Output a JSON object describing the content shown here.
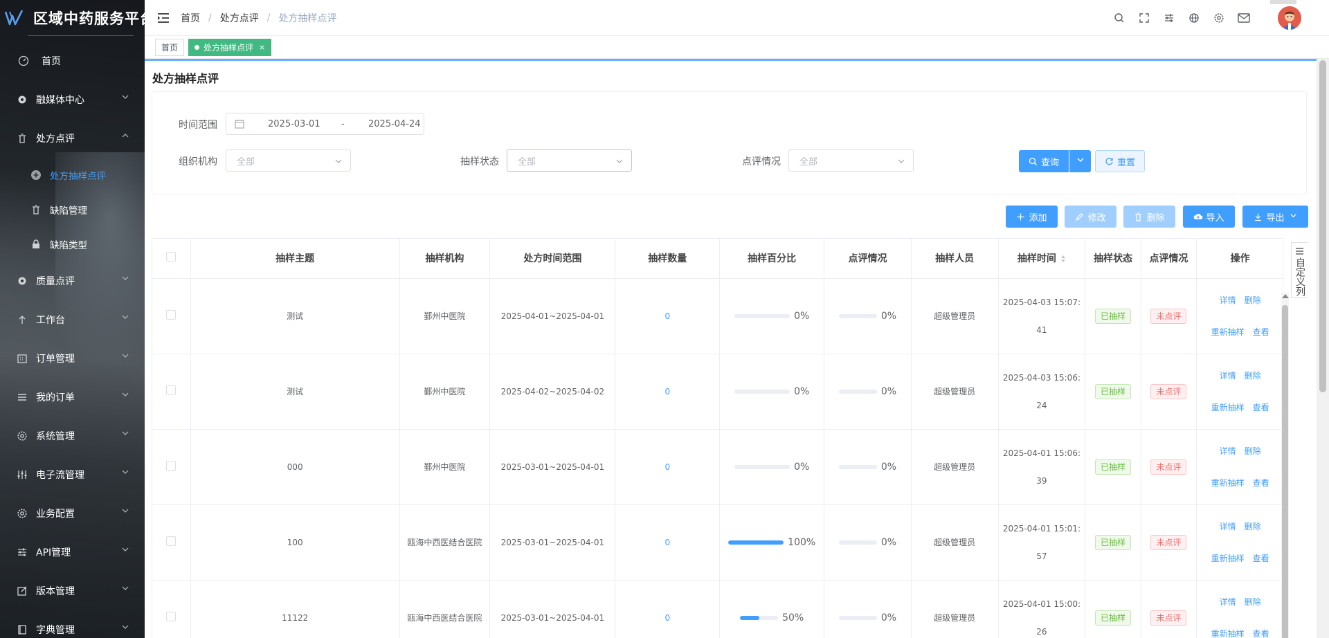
{
  "app": {
    "title": "区域中药服务平台"
  },
  "sidebar": {
    "items": [
      {
        "label": "首页",
        "icon": "dashboard-icon"
      },
      {
        "label": "融媒体中心",
        "icon": "settings-icon"
      },
      {
        "label": "处方点评",
        "icon": "trash-icon"
      },
      {
        "label": "处方抽样点评",
        "icon": "plus-circle-icon",
        "active": true
      },
      {
        "label": "缺陷管理",
        "icon": "trash-icon"
      },
      {
        "label": "缺陷类型",
        "icon": "lock-icon"
      },
      {
        "label": "质量点评",
        "icon": "settings-icon"
      },
      {
        "label": "工作台",
        "icon": "arrow-up-icon"
      },
      {
        "label": "订单管理",
        "icon": "calendar-icon"
      },
      {
        "label": "我的订单",
        "icon": "list-icon"
      },
      {
        "label": "系统管理",
        "icon": "gear-icon"
      },
      {
        "label": "电子流管理",
        "icon": "flow-icon"
      },
      {
        "label": "业务配置",
        "icon": "gear-icon"
      },
      {
        "label": "API管理",
        "icon": "sliders-icon"
      },
      {
        "label": "版本管理",
        "icon": "edit-icon"
      },
      {
        "label": "字典管理",
        "icon": "book-icon"
      }
    ]
  },
  "breadcrumb": {
    "home": "首页",
    "parent": "处方点评",
    "current": "处方抽样点评"
  },
  "tags": {
    "home": "首页",
    "active": "处方抽样点评",
    "close": "×"
  },
  "page": {
    "title": "处方抽样点评"
  },
  "filters": {
    "time_label": "时间范围",
    "start_date": "2025-03-01",
    "separator": "-",
    "end_date": "2025-04-24",
    "org_label": "组织机构",
    "org_value": "全部",
    "status_label": "抽样状态",
    "status_value": "全部",
    "review_label": "点评情况",
    "review_value": "全部",
    "query": "查询",
    "reset": "重置"
  },
  "actions": {
    "add": "添加",
    "edit": "修改",
    "delete": "删除",
    "import": "导入",
    "export": "导出"
  },
  "table": {
    "headers": [
      "抽样主题",
      "抽样机构",
      "处方时间范围",
      "抽样数量",
      "抽样百分比",
      "点评情况",
      "抽样人员",
      "抽样时间",
      "抽样状态",
      "点评情况",
      "操作"
    ],
    "custom_columns": "自定义列",
    "op_labels": {
      "detail": "详情",
      "delete": "删除",
      "resample": "重新抽样",
      "view": "查看"
    },
    "rows": [
      {
        "topic": "测试",
        "org": "鄞州中医院",
        "range": "2025-04-01~2025-04-01",
        "count": "0",
        "percent": 0,
        "percent_text": "0%",
        "review_pct": 0,
        "review_pct_text": "0%",
        "person": "超级管理员",
        "time_a": "2025-04-03 15:07:",
        "time_b": "41",
        "status": "已抽样",
        "review": "未点评"
      },
      {
        "topic": "测试",
        "org": "鄞州中医院",
        "range": "2025-04-02~2025-04-02",
        "count": "0",
        "percent": 0,
        "percent_text": "0%",
        "review_pct": 0,
        "review_pct_text": "0%",
        "person": "超级管理员",
        "time_a": "2025-04-03 15:06:",
        "time_b": "24",
        "status": "已抽样",
        "review": "未点评"
      },
      {
        "topic": "000",
        "org": "鄞州中医院",
        "range": "2025-03-01~2025-04-01",
        "count": "0",
        "percent": 0,
        "percent_text": "0%",
        "review_pct": 0,
        "review_pct_text": "0%",
        "person": "超级管理员",
        "time_a": "2025-04-01 15:06:",
        "time_b": "39",
        "status": "已抽样",
        "review": "未点评"
      },
      {
        "topic": "100",
        "org": "瓯海中西医结合医院",
        "range": "2025-03-01~2025-04-01",
        "count": "0",
        "percent": 100,
        "percent_text": "100%",
        "review_pct": 0,
        "review_pct_text": "0%",
        "person": "超级管理员",
        "time_a": "2025-04-01 15:01:",
        "time_b": "57",
        "status": "已抽样",
        "review": "未点评"
      },
      {
        "topic": "11122",
        "org": "瓯海中西医结合医院",
        "range": "2025-03-01~2025-04-01",
        "count": "0",
        "percent": 50,
        "percent_text": "50%",
        "review_pct": 0,
        "review_pct_text": "0%",
        "person": "超级管理员",
        "time_a": "2025-04-01 15:00:",
        "time_b": "26",
        "status": "已抽样",
        "review": "未点评"
      }
    ]
  },
  "colors": {
    "primary": "#409eff",
    "success": "#67c23a",
    "danger": "#f56c6c",
    "tag_active": "#42b983"
  }
}
